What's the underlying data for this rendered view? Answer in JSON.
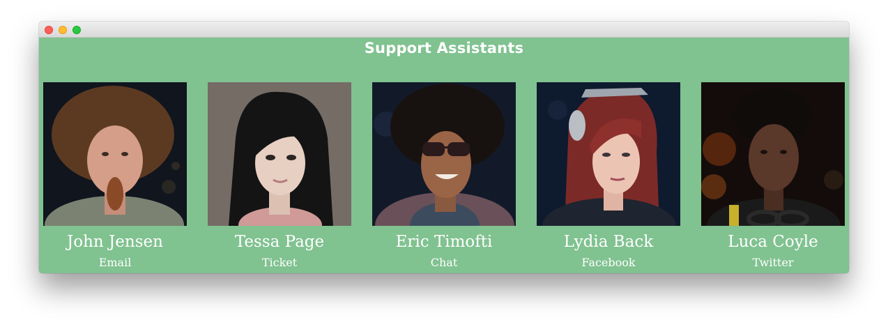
{
  "window": {
    "title_text": "Support Assistants"
  },
  "colors": {
    "background": "#80c290",
    "text": "#ffffff"
  },
  "assistants": [
    {
      "name": "John Jensen",
      "channel": "Email",
      "photo": "portrait-photo"
    },
    {
      "name": "Tessa Page",
      "channel": "Ticket",
      "photo": "portrait-photo"
    },
    {
      "name": "Eric Timofti",
      "channel": "Chat",
      "photo": "portrait-photo"
    },
    {
      "name": "Lydia Back",
      "channel": "Facebook",
      "photo": "portrait-photo"
    },
    {
      "name": "Luca Coyle",
      "channel": "Twitter",
      "photo": "portrait-photo"
    }
  ]
}
